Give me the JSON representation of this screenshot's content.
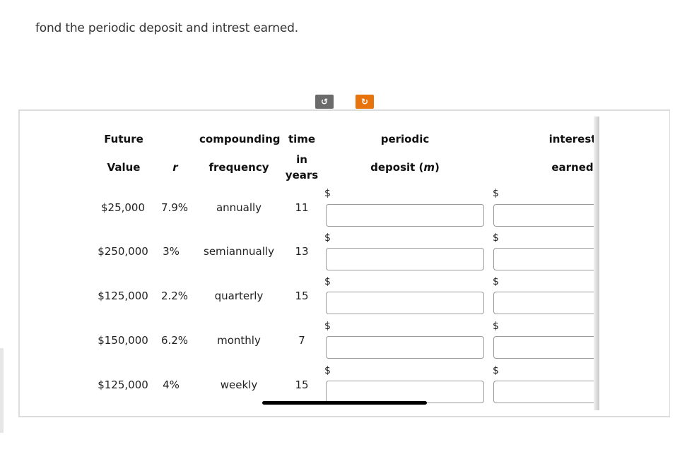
{
  "prompt": "fond the periodic deposit and intrest earned.",
  "toolbar": {
    "undo_icon": "↺",
    "reset_icon": "↻",
    "reset_color": "#e8730c",
    "undo_color": "#6b6b6b"
  },
  "headers": {
    "future_value": [
      "Future",
      "Value"
    ],
    "rate": "r",
    "compounding": [
      "compounding",
      "frequency"
    ],
    "time": [
      "time",
      "in",
      "years"
    ],
    "deposit": [
      "periodic",
      "deposit (",
      "m",
      ")"
    ],
    "interest": [
      "interest",
      "earned"
    ]
  },
  "currency_symbol": "$",
  "rows": [
    {
      "future_value": "$25,000",
      "rate": "7.9%",
      "frequency": "annually",
      "years": "11",
      "deposit": "",
      "interest": ""
    },
    {
      "future_value": "$250,000",
      "rate": "3%",
      "frequency": "semiannually",
      "years": "13",
      "deposit": "",
      "interest": ""
    },
    {
      "future_value": "$125,000",
      "rate": "2.2%",
      "frequency": "quarterly",
      "years": "15",
      "deposit": "",
      "interest": ""
    },
    {
      "future_value": "$150,000",
      "rate": "6.2%",
      "frequency": "monthly",
      "years": "7",
      "deposit": "",
      "interest": ""
    },
    {
      "future_value": "$125,000",
      "rate": "4%",
      "frequency": "weekly",
      "years": "15",
      "deposit": "",
      "interest": ""
    }
  ]
}
